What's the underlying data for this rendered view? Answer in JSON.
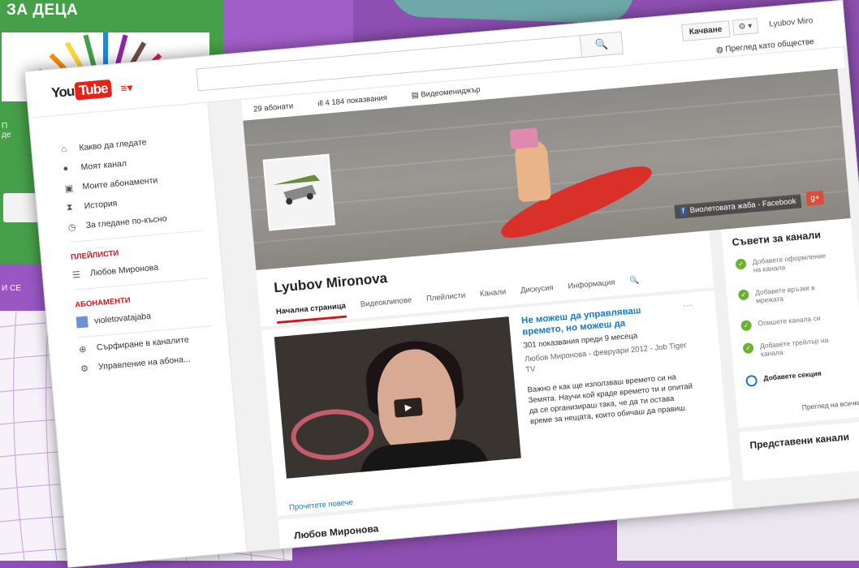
{
  "background": {
    "green_title": "ЗА ДЕЦА",
    "green_fragment_1": "П",
    "green_fragment_2": "де",
    "purple_fragment": "И СЕ"
  },
  "topbar": {
    "logo_you": "You",
    "logo_tube": "Tube",
    "search_icon": "🔍",
    "upload_label": "Качване",
    "settings_label": "⚙ ▾",
    "user_name": "Lyubov Miro",
    "public_view": "Преглед като обществе"
  },
  "sidebar": {
    "items": [
      {
        "icon": "home-icon",
        "glyph": "⌂",
        "label": "Какво да гледате"
      },
      {
        "icon": "user-icon",
        "glyph": "●",
        "label": "Моят канал"
      },
      {
        "icon": "subscriptions-icon",
        "glyph": "▣",
        "label": "Моите абонаменти"
      },
      {
        "icon": "history-icon",
        "glyph": "⧗",
        "label": "История"
      },
      {
        "icon": "watch-later-icon",
        "glyph": "◷",
        "label": "За гледане по-късно"
      }
    ],
    "playlists_title": "ПЛЕЙЛИСТИ",
    "playlist_item": "Любов Миронова",
    "subscriptions_title": "АБОНАМЕНТИ",
    "subscription_item": "violetovatajaba",
    "browse_channels": "Сърфиране в каналите",
    "manage_subscriptions": "Управление на абона..."
  },
  "stats": {
    "subscribers": "29 абонати",
    "views": "4 184 показвания",
    "video_manager": "Видеомениджър"
  },
  "banner": {
    "facebook_link": "Виолетовата жаба - Facebook",
    "gplus": "g+"
  },
  "channel": {
    "name": "Lyubov Mironova",
    "tabs": [
      "Начална страница",
      "Видеоклипове",
      "Плейлисти",
      "Канали",
      "Дискусия",
      "Информация"
    ]
  },
  "featured_video": {
    "title": "Не можеш да управляваш времето, но можеш да",
    "meta": "301 показвания  преди 9 месеца",
    "author": "Любов Миронова - февруари 2012 - Job Tiger TV",
    "description": "Важно е как ще използваш времето си на Земята. Научи кой краде времето ти и опитай да се организираш така, че да ти остава време за нещата, които обичаш да правиш.",
    "read_more": "Прочетете повече"
  },
  "section2": {
    "title": "Любов Миронова"
  },
  "tips": {
    "title": "Съвети за канали",
    "items": [
      {
        "done": true,
        "label": "Добавете оформление на канала"
      },
      {
        "done": true,
        "label": "Добавете връзки в мрежата"
      },
      {
        "done": true,
        "label": "Опишете канала си"
      },
      {
        "done": true,
        "label": "Добавете трейлър на канала"
      },
      {
        "done": false,
        "label": "Добавете секция"
      }
    ],
    "view_all": "Преглед на всички"
  },
  "featured_channels": {
    "title": "Представени канали"
  }
}
